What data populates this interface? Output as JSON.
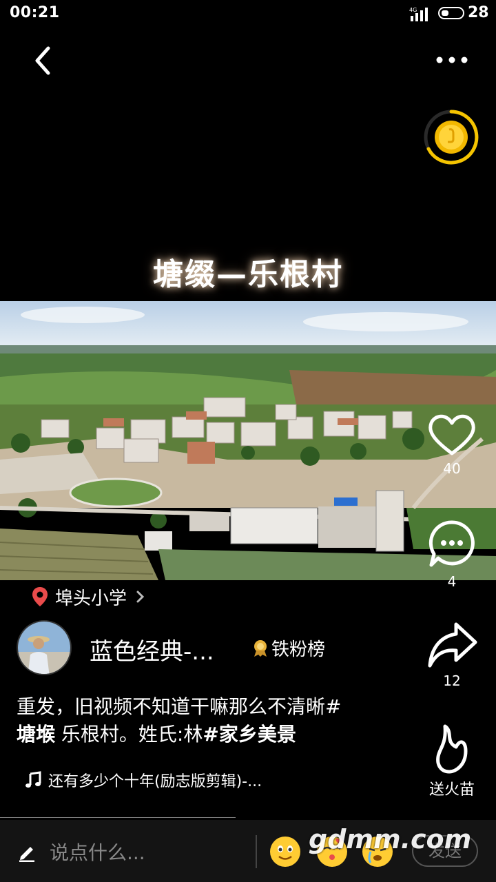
{
  "status_bar": {
    "time": "00:21",
    "network": "4G",
    "battery": "28"
  },
  "video": {
    "title_overlay": "塘缀—乐根村"
  },
  "actions": {
    "like_count": "40",
    "comment_count": "4",
    "share_count": "12",
    "fire_label": "送火苗"
  },
  "location": {
    "label": "埠头小学"
  },
  "author": {
    "name": "蓝色经典-...",
    "badge": "铁粉榜"
  },
  "caption": {
    "line1": "重发，旧视频不知道干嘛那么不清晰#",
    "tag1": "塘堠",
    "line2": " 乐根村。姓氏:林",
    "tag2": "#家乡美景"
  },
  "music": {
    "title": "还有多少个十年(励志版剪辑)-..."
  },
  "bottom": {
    "placeholder": "说点什么...",
    "send_label": "发送"
  },
  "watermark": "gdmm.com",
  "colors": {
    "accent_yellow": "#f5c400",
    "location_pin": "#e94b4b",
    "badge_gold": "#e8b33a"
  }
}
